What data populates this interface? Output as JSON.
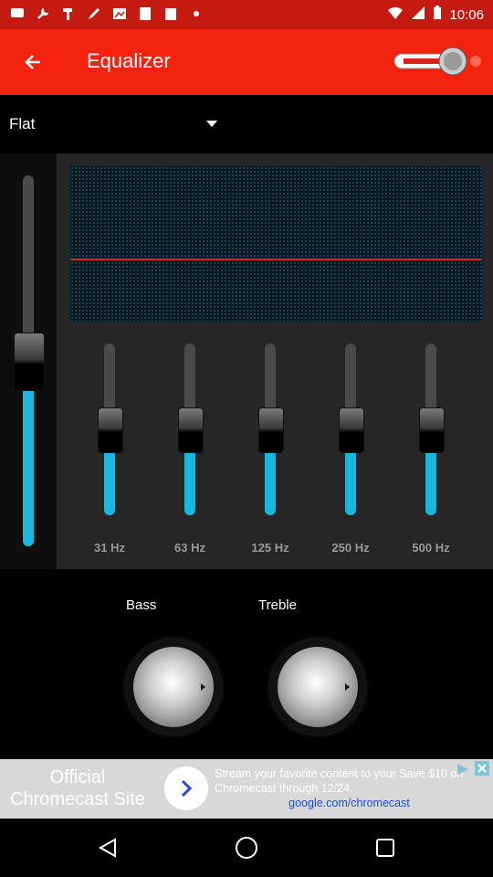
{
  "status_bar": {
    "time": "10:06",
    "left_icons": [
      "message-icon",
      "wrench-icon",
      "hammer-icon",
      "pencil-icon",
      "photo-icon",
      "document-icon",
      "clipboard-icon",
      "dot-icon"
    ],
    "right_icons": [
      "wifi-icon",
      "signal-icon",
      "battery-icon"
    ]
  },
  "app_bar": {
    "title": "Equalizer",
    "back_icon": "arrow-left-icon",
    "toggle_state": "on"
  },
  "preset": {
    "label": "Flat"
  },
  "equalizer": {
    "preamp_level": 0.5,
    "bands": [
      {
        "label": "31 Hz",
        "level": 0.5
      },
      {
        "label": "63 Hz",
        "level": 0.5
      },
      {
        "label": "125 Hz",
        "level": 0.5
      },
      {
        "label": "250 Hz",
        "level": 0.5
      },
      {
        "label": "500 Hz",
        "level": 0.5
      }
    ],
    "colors": {
      "fill": "#18b8df",
      "curve": "#e02020"
    }
  },
  "tone": {
    "bass_label": "Bass",
    "treble_label": "Treble"
  },
  "ad": {
    "title": "Official Chromecast Site",
    "body": "Stream your favorite content to your Save $10 on Chromecast through 12/24.",
    "url": "google.com/chromecast"
  },
  "nav": {
    "back_icon": "triangle-back-icon",
    "home_icon": "circle-home-icon",
    "recents_icon": "square-recents-icon"
  },
  "colors": {
    "accent": "#f4230f",
    "status_bar": "#c41a10"
  }
}
